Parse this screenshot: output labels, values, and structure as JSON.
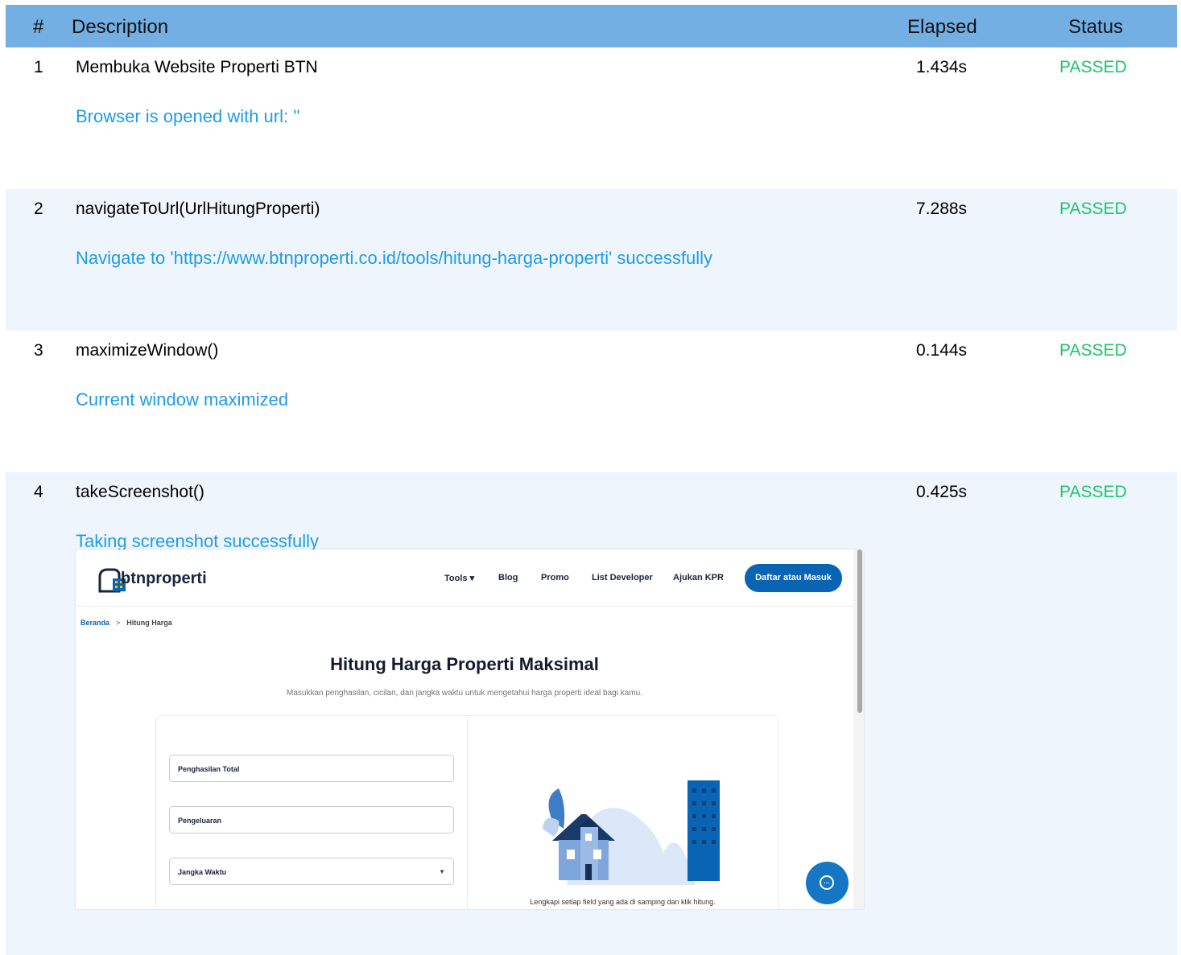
{
  "table": {
    "headers": {
      "num": "#",
      "description": "Description",
      "elapsed": "Elapsed",
      "status": "Status"
    },
    "rows": [
      {
        "num": "1",
        "title": "Membuka Website Properti BTN",
        "elapsed": "1.434s",
        "status": "PASSED",
        "message": "Browser is opened with url: ''"
      },
      {
        "num": "2",
        "title": "navigateToUrl(UrlHitungProperti)",
        "elapsed": "7.288s",
        "status": "PASSED",
        "message": "Navigate to 'https://www.btnproperti.co.id/tools/hitung-harga-properti' successfully"
      },
      {
        "num": "3",
        "title": "maximizeWindow()",
        "elapsed": "0.144s",
        "status": "PASSED",
        "message": "Current window maximized"
      },
      {
        "num": "4",
        "title": "takeScreenshot()",
        "elapsed": "0.425s",
        "status": "PASSED",
        "message": "Taking screenshot successfully"
      }
    ]
  },
  "screenshot": {
    "brand": "btnproperti",
    "nav": {
      "tools": "Tools",
      "blog": "Blog",
      "promo": "Promo",
      "list_developer": "List Developer",
      "ajukan_kpr": "Ajukan KPR",
      "cta": "Daftar atau Masuk"
    },
    "breadcrumb": {
      "home": "Beranda",
      "current": "Hitung Harga"
    },
    "title": "Hitung Harga Properti Maksimal",
    "subtitle": "Masukkan penghasilan, cicilan, dan jangka waktu untuk mengetahui harga properti ideal bagi kamu.",
    "fields": {
      "income": "Penghasilan Total",
      "expense": "Pengeluaran",
      "term": "Jangka Waktu"
    },
    "illustration_caption": "Lengkapi setiap field yang ada di samping dan klik hitung."
  },
  "colors": {
    "header": "#74afe4",
    "passed": "#1ec46b",
    "message": "#1f9be8",
    "brand_blue": "#0a64b4"
  }
}
